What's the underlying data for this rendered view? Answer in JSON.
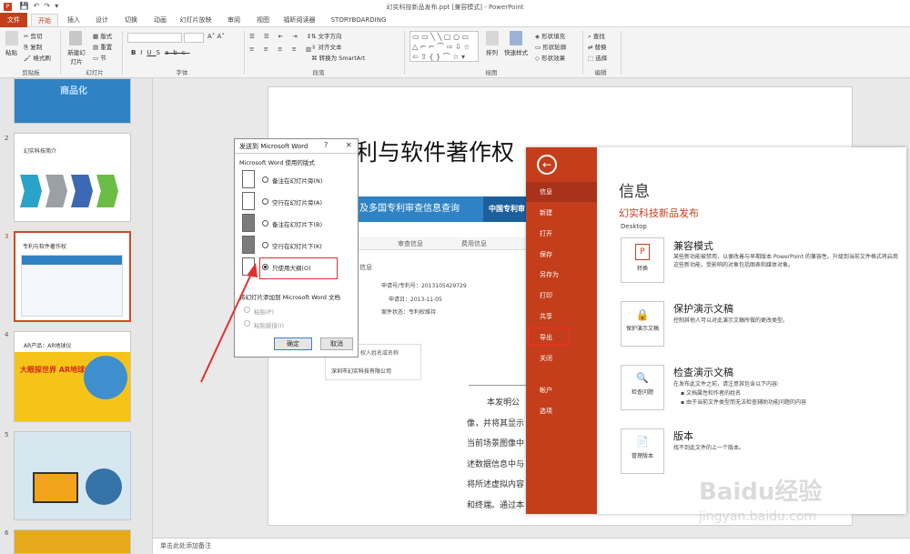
{
  "window": {
    "title": "幻实科技新品发布.ppt [兼容模式] - PowerPoint"
  },
  "tabs": [
    "文件",
    "开始",
    "插入",
    "设计",
    "切换",
    "动画",
    "幻灯片放映",
    "审阅",
    "视图",
    "福昕阅读器",
    "STORYBOARDING"
  ],
  "ribbon": {
    "clipboard": {
      "paste": "粘贴",
      "cut": "剪切",
      "copy": "复制",
      "format_painter": "格式刷",
      "label": "剪贴板"
    },
    "slides": {
      "new_slide": "新建幻灯片",
      "layout": "版式",
      "reset": "重置",
      "section": "节",
      "label": "幻灯片"
    },
    "font": {
      "label": "字体",
      "bold": "B",
      "italic": "I",
      "underline": "U",
      "shadow": "S",
      "strike": "abc"
    },
    "paragraph": {
      "text_direction": "文字方向",
      "align_text": "对齐文本",
      "smartart": "转换为 SmartArt",
      "label": "段落"
    },
    "drawing": {
      "arrange": "排列",
      "quick_styles": "快速样式",
      "shape_fill": "形状填充",
      "shape_outline": "形状轮廓",
      "shape_effects": "形状效果",
      "label": "绘图"
    },
    "editing": {
      "find": "查找",
      "replace": "替换",
      "select": "选择",
      "label": "编辑"
    }
  },
  "thumbnails": [
    {
      "num": "1",
      "text": "商品化"
    },
    {
      "num": "2",
      "text": "幻实科技简介"
    },
    {
      "num": "3",
      "text": "专利与软件著作权"
    },
    {
      "num": "4",
      "text": "AR产品：AR地球仪",
      "sub": "大眼探世界 AR地球仪"
    },
    {
      "num": "5",
      "text": ""
    },
    {
      "num": "6",
      "text": ""
    }
  ],
  "slide": {
    "title": "专利与软件著作权",
    "banner_left": "及多国专利审查信息查询",
    "banner_right": "中国专利审",
    "tabs": [
      "审查信息",
      "费用信息"
    ],
    "info_heading": "信息",
    "app_no": "申请号/专利号：2013105429729",
    "app_date": "申请日：2013-11-05",
    "status": "案件状态：专利权维持",
    "applicant_header": "权人姓名或名称",
    "applicant": "深圳市幻实科技有限公司",
    "body_lines": [
      "本发明公",
      "像，并将其显示",
      "当前场景图像中",
      "述数据信息中与",
      "将所述虚拟内容",
      "和终端。通过本"
    ]
  },
  "notes": {
    "placeholder": "单击此处添加备注"
  },
  "dialog": {
    "title": "发送到 Microsoft Word",
    "help": "?",
    "close": "✕",
    "layout_heading": "Microsoft Word 使用的版式",
    "options": [
      {
        "label": "备注在幻灯片旁(N)",
        "selected": false
      },
      {
        "label": "空行在幻灯片旁(A)",
        "selected": false
      },
      {
        "label": "备注在幻灯片下(B)",
        "selected": false
      },
      {
        "label": "空行在幻灯片下(K)",
        "selected": false
      },
      {
        "label": "只使用大纲(O)",
        "selected": true
      }
    ],
    "add_heading": "将幻灯片添加到 Microsoft Word 文档",
    "paste": "粘贴(P)",
    "paste_link": "粘贴链接(I)",
    "ok": "确定",
    "cancel": "取消"
  },
  "backstage": {
    "nav": [
      "信息",
      "新建",
      "打开",
      "保存",
      "另存为",
      "打印",
      "共享",
      "导出",
      "关闭",
      "帐户",
      "选项"
    ],
    "heading": "信息",
    "file_title": "幻实科技新品发布",
    "location": "Desktop",
    "sections": [
      {
        "button": "转换",
        "title": "兼容模式",
        "desc": "某些新功能被禁用，以便改善与早期版本 PowerPoint 的兼容性。升级到当前文件格式将启用这些新功能，受影响的对象包括图表和媒体对象。"
      },
      {
        "button": "保护演示文稿",
        "title": "保护演示文稿",
        "desc": "控制其他人可以对此演示文稿所做的更改类型。"
      },
      {
        "button": "检查问题",
        "title": "检查演示文稿",
        "desc": "在发布此文件之前，请注意其包含以下内容:",
        "bullets": [
          "文档属性和作者的姓名",
          "由于当前文件类型而无法检查辅助功能问题的内容"
        ]
      },
      {
        "button": "管理版本",
        "title": "版本",
        "desc": "找不到此文件的上一个版本。"
      }
    ]
  },
  "watermark": {
    "line1": "Baidu经验",
    "line2": "jingyan.baidu.com"
  },
  "colors": {
    "accent": "#c43e1c",
    "highlight_box": "#e03030",
    "arrow": "#e03030",
    "banner_blue": "#2f83c4"
  }
}
